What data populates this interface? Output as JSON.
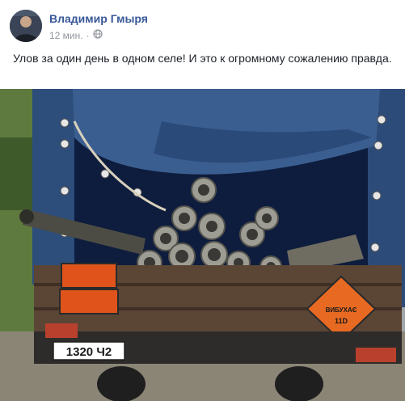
{
  "post": {
    "author": "Владимир Гмыря",
    "timestamp": "12 мин.",
    "text": "Улов за один день в одном селе! И это к огромному сожалению правда."
  },
  "photo": {
    "license_plate": "1320 Ч2",
    "hazard_sign_line1": "ВИБУХАЄ",
    "hazard_sign_line2": "11D"
  },
  "icons": {
    "audience": "globe-icon"
  }
}
